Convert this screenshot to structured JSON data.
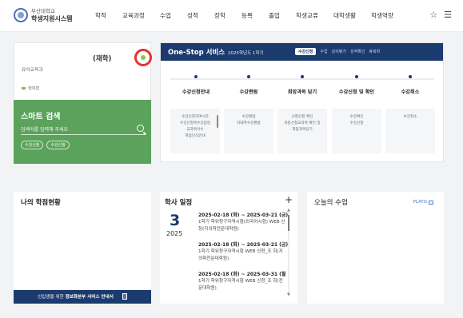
{
  "header": {
    "logo_line1": "부산대학교",
    "logo_line2": "학생지원시스템",
    "nav": [
      "학적",
      "교육과정",
      "수업",
      "성적",
      "장학",
      "등록",
      "졸업",
      "학생교류",
      "대학생활",
      "학생역량"
    ],
    "star_icon": "☆",
    "menu_icon": "☰"
  },
  "profile": {
    "status": "(재학)",
    "department": "유아교육과",
    "mini_label": "행복함"
  },
  "smart_search": {
    "title": "스마트 검색",
    "placeholder": "검색어를 입력해 주세요",
    "chips": [
      "수강신청",
      "수강신청"
    ]
  },
  "onestop": {
    "title": "One-Stop 서비스",
    "term": "2025학년도 1학기",
    "tabs": [
      "수강신청",
      "수업",
      "강의평가",
      "성적확인",
      "휴복학"
    ],
    "steps": [
      {
        "label": "수강신청안내",
        "items": [
          "수강신청하여시하",
          "수강신청목수강점정",
          "교과목이수",
          "학점인식안내"
        ]
      },
      {
        "label": "수강편람",
        "items": [
          "수강편람",
          "타대학수강편람"
        ]
      },
      {
        "label": "희망과목 담기",
        "items": [
          "신청신청 확인",
          "자동신청교과목 확인 및",
          "희망과목담기"
        ]
      },
      {
        "label": "수강신청 및 확인",
        "items": [
          "수강확인",
          "수강신청"
        ]
      },
      {
        "label": "수강취소",
        "items": [
          "수강취소"
        ]
      }
    ]
  },
  "credits": {
    "title": "나의 학점현황",
    "notice_prefix": "신입생을 위한 ",
    "notice_bold": "정보화본부 서비스 안내서"
  },
  "academic": {
    "title": "학사 일정",
    "plus": "+",
    "day": "3",
    "year": "2025",
    "events": [
      {
        "date": "2025-02-18 (화) ~ 2025-03-21 (금)",
        "desc": "1학기 학위청구자격시험(외국어시험) WEB 신청(지의학전문대학원)"
      },
      {
        "date": "2025-02-18 (화) ~ 2025-03-21 (금)",
        "desc": "1학기 학위청구자격시험 WEB 신청_조 회(지의학전문대학원)"
      },
      {
        "date": "2025-02-18 (화) ~ 2025-03-31 (월)",
        "desc": "1학기 학위청구자격시험 WEB 신청_조 회(전문대학원)"
      }
    ]
  },
  "today": {
    "title": "오늘의 수업",
    "plato": "PLATO"
  },
  "colors": {
    "navy": "#1b3b6f",
    "green": "#5ba25c",
    "avatar_ring": "#e03434"
  }
}
